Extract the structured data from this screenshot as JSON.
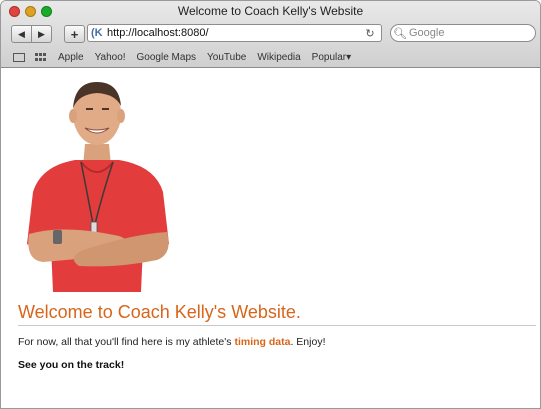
{
  "window": {
    "title": "Welcome to Coach Kelly's Website",
    "traffic_lights": {
      "close": "#e0443e",
      "minimize": "#dea123",
      "zoom": "#1aab29"
    }
  },
  "toolbar": {
    "back_icon": "back-arrow-icon",
    "forward_icon": "forward-arrow-icon",
    "add_label": "+",
    "url": "http://localhost:8080/",
    "search_placeholder": "Google"
  },
  "bookmarks": {
    "items": [
      {
        "label": "Apple"
      },
      {
        "label": "Yahoo!"
      },
      {
        "label": "Google Maps"
      },
      {
        "label": "YouTube"
      },
      {
        "label": "Wikipedia"
      },
      {
        "label": "Popular▾"
      }
    ]
  },
  "page": {
    "heading": "Welcome to Coach Kelly's Website.",
    "para_before": "For now, all that you'll find here is my athlete's ",
    "para_link": "timing data",
    "para_after": ". Enjoy!",
    "closing": "See you on the track!",
    "accent_color": "#d8651a"
  }
}
